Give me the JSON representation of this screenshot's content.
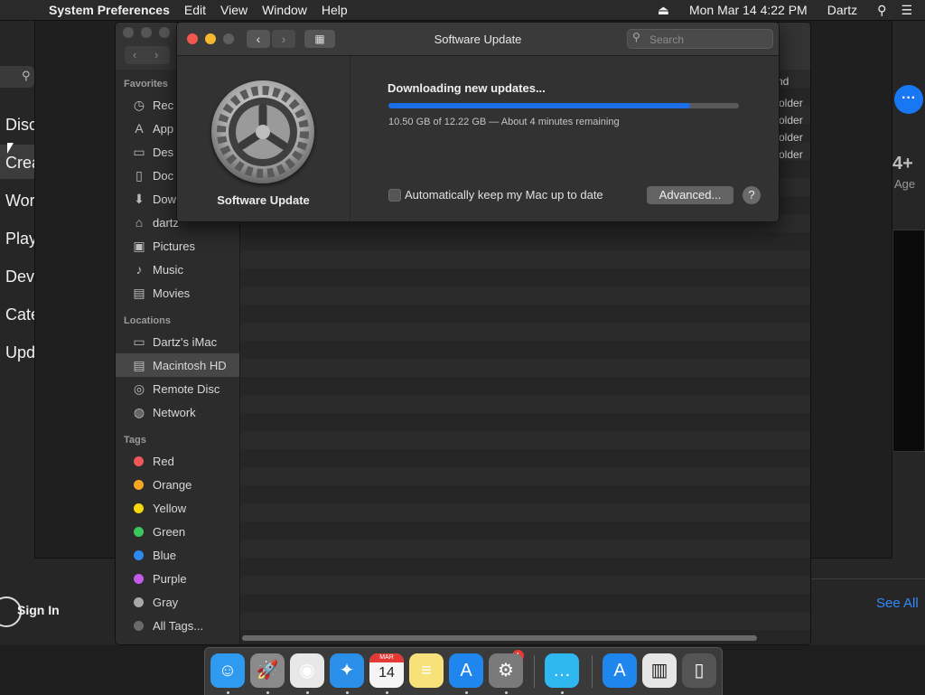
{
  "menubar": {
    "apple": "",
    "app_name": "System Preferences",
    "menus": [
      "Edit",
      "View",
      "Window",
      "Help"
    ],
    "eject": "⏏",
    "datetime": "Mon Mar 14  4:22 PM",
    "user": "Dartz"
  },
  "appstore": {
    "sidebar": [
      "Disc",
      "Crea",
      "Wor",
      "Play",
      "Dev",
      "Cate",
      "Upd"
    ],
    "more": "···",
    "age": "4+",
    "age_label": "Age",
    "sign_in": "Sign In",
    "see_all": "See All"
  },
  "finder": {
    "favorites_head": "Favorites",
    "favorites": [
      {
        "icon": "◷",
        "label": "Rec"
      },
      {
        "icon": "A",
        "label": "App"
      },
      {
        "icon": "▭",
        "label": "Des"
      },
      {
        "icon": "▯",
        "label": "Doc"
      },
      {
        "icon": "⬇",
        "label": "Dow"
      },
      {
        "icon": "⌂",
        "label": "dartz"
      },
      {
        "icon": "▣",
        "label": "Pictures"
      },
      {
        "icon": "♪",
        "label": "Music"
      },
      {
        "icon": "▤",
        "label": "Movies"
      }
    ],
    "locations_head": "Locations",
    "locations": [
      {
        "icon": "▭",
        "label": "Dartz's iMac"
      },
      {
        "icon": "▤",
        "label": "Macintosh HD"
      },
      {
        "icon": "◎",
        "label": "Remote Disc"
      },
      {
        "icon": "◍",
        "label": "Network"
      }
    ],
    "tags_head": "Tags",
    "tags": [
      {
        "color": "#f0555a",
        "label": "Red"
      },
      {
        "color": "#f5a623",
        "label": "Orange"
      },
      {
        "color": "#f5d90a",
        "label": "Yellow"
      },
      {
        "color": "#3bc75b",
        "label": "Green"
      },
      {
        "color": "#2c8af0",
        "label": "Blue"
      },
      {
        "color": "#c25ce8",
        "label": "Purple"
      },
      {
        "color": "#a8a8a8",
        "label": "Gray"
      },
      {
        "color": "#6a6a6a",
        "label": "All Tags..."
      }
    ],
    "kind_header": "nd",
    "kind_values": [
      "older",
      "older",
      "older",
      "older"
    ]
  },
  "software_update": {
    "title": "Software Update",
    "search_placeholder": "Search",
    "name": "Software Update",
    "status_title": "Downloading new updates...",
    "progress": 0.86,
    "status_detail": "10.50 GB of 12.22 GB — About 4 minutes remaining",
    "auto_update_label": "Automatically keep my Mac up to date",
    "advanced_label": "Advanced...",
    "help_label": "?"
  },
  "dock": {
    "apps": [
      {
        "name": "finder-icon",
        "glyph": "☺",
        "color": "#2e9bf0"
      },
      {
        "name": "launchpad-icon",
        "glyph": "🚀",
        "color": "#8a8a8a"
      },
      {
        "name": "chrome-icon",
        "glyph": "◉",
        "color": "#e8e8e8"
      },
      {
        "name": "safari-icon",
        "glyph": "✦",
        "color": "#2a8fe8"
      },
      {
        "name": "calendar-icon",
        "glyph": "14",
        "color": "#f5f5f5"
      },
      {
        "name": "notes-icon",
        "glyph": "≡",
        "color": "#f7e27a"
      },
      {
        "name": "app-store-icon",
        "glyph": "A",
        "color": "#1f86ee"
      },
      {
        "name": "system-preferences-icon",
        "glyph": "⚙",
        "color": "#7a7a7a"
      },
      {
        "name": "messages-icon",
        "glyph": "…",
        "color": "#2fb8f0"
      },
      {
        "name": "app-store-download-icon",
        "glyph": "A",
        "color": "#1f86ee"
      },
      {
        "name": "document-icon",
        "glyph": "▥",
        "color": "#e6e6e6"
      },
      {
        "name": "trash-icon",
        "glyph": "▯",
        "color": "#555555"
      }
    ],
    "calendar_month": "MAR",
    "badge": "1"
  }
}
